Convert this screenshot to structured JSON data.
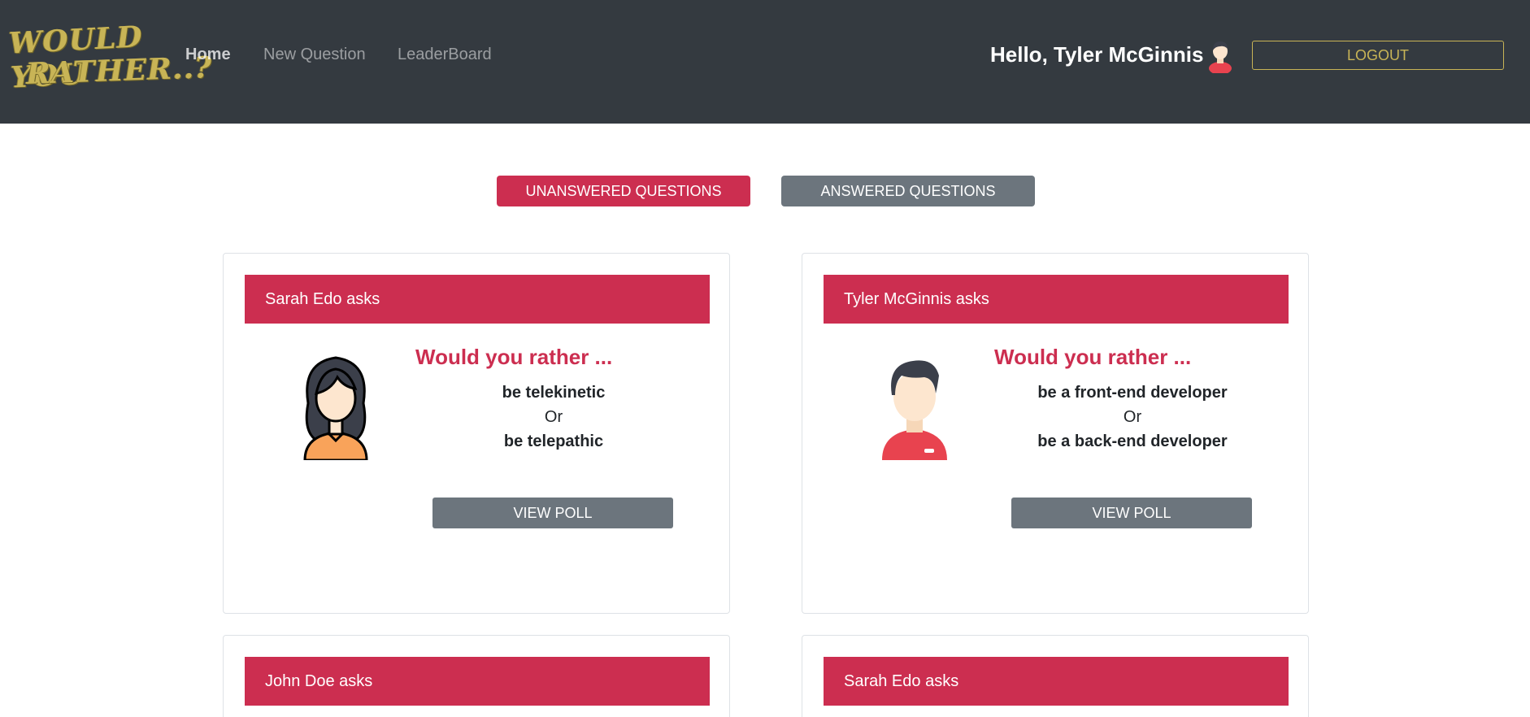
{
  "nav": {
    "logo_text_line1": "WOULD YOU",
    "logo_text_line2": "RATHER..?",
    "links": [
      {
        "label": "Home",
        "active": true
      },
      {
        "label": "New Question",
        "active": false
      },
      {
        "label": "LeaderBoard",
        "active": false
      }
    ],
    "greeting": "Hello, Tyler McGinnis",
    "logout_label": "LOGOUT"
  },
  "tabs": {
    "unanswered_label": "UNANSWERED QUESTIONS",
    "answered_label": "ANSWERED QUESTIONS"
  },
  "questions": [
    {
      "author": "Sarah Edo asks",
      "avatar": "female-avatar-icon",
      "prompt": "Would you rather ...",
      "option_one": "be telekinetic",
      "or_label": "Or",
      "option_two": "be telepathic",
      "button_label": "VIEW POLL"
    },
    {
      "author": "Tyler McGinnis asks",
      "avatar": "male-avatar-icon",
      "prompt": "Would you rather ...",
      "option_one": "be a front-end developer",
      "or_label": "Or",
      "option_two": "be a back-end developer",
      "button_label": "VIEW POLL"
    },
    {
      "author": "John Doe asks"
    },
    {
      "author": "Sarah Edo asks"
    }
  ],
  "colors": {
    "navbar_bg": "#343a40",
    "accent_red": "#cc2e50",
    "logo_gold": "#c8b456",
    "secondary_gray": "#6c757d"
  }
}
